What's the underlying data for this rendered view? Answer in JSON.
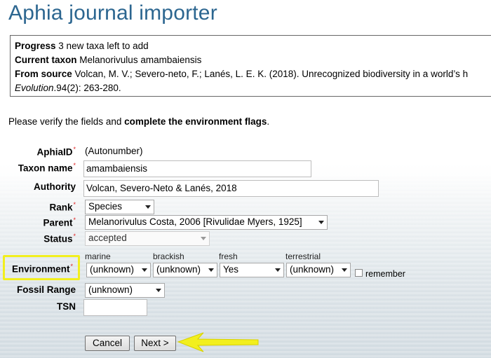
{
  "page": {
    "title": "Aphia journal importer"
  },
  "info": {
    "progress_label": "Progress",
    "progress_value": "3 new taxa left to add",
    "current_label": "Current taxon",
    "current_value": "Melanorivulus amambaiensis",
    "source_label": "From source",
    "source_value": "Volcan, M. V.; Severo-neto, F.; Lanés, L. E. K. (2018). Unrecognized biodiversity in a world’s h",
    "source_journal": "Evolution",
    "source_rest": ".94(2): 263-280."
  },
  "intro": {
    "text": "Please verify the fields and ",
    "bold": "complete the environment flags",
    "end": "."
  },
  "form": {
    "aphiaid": {
      "label": "AphiaID",
      "required": "*",
      "value": "(Autonumber)"
    },
    "taxon_name": {
      "label": "Taxon name",
      "required": "*",
      "value": "amambaiensis"
    },
    "authority": {
      "label": "Authority",
      "value": "Volcan, Severo-Neto & Lanés, 2018"
    },
    "rank": {
      "label": "Rank",
      "required": "*",
      "value": "Species"
    },
    "parent": {
      "label": "Parent",
      "required": "*",
      "value": "Melanorivulus Costa, 2006 [Rivulidae Myers, 1925]"
    },
    "status": {
      "label": "Status",
      "required": "*",
      "value": "accepted"
    },
    "environment": {
      "label": "Environment",
      "required": "*",
      "marine": {
        "header": "marine",
        "value": "(unknown)"
      },
      "brackish": {
        "header": "brackish",
        "value": "(unknown)"
      },
      "fresh": {
        "header": "fresh",
        "value": "Yes"
      },
      "terrestrial": {
        "header": "terrestrial",
        "value": "(unknown)"
      },
      "remember_label": "remember"
    },
    "fossil_range": {
      "label": "Fossil Range",
      "value": "(unknown)"
    },
    "tsn": {
      "label": "TSN",
      "value": ""
    }
  },
  "buttons": {
    "cancel": "Cancel",
    "next": "Next >"
  },
  "colors": {
    "title": "#2c6690",
    "highlight": "#f2ef1e",
    "arrow": "#f2ef1e",
    "required": "#e02020"
  }
}
